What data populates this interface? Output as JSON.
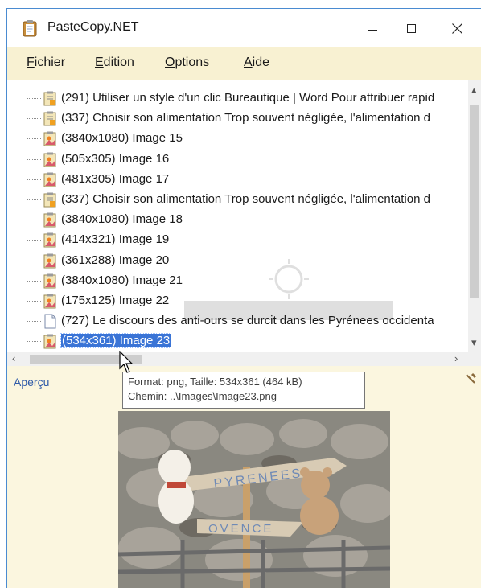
{
  "window": {
    "title": "PasteCopy.NET",
    "controls": [
      "minimize-icon",
      "maximize-icon",
      "close-icon"
    ]
  },
  "menu": {
    "items": [
      {
        "mnemonic": "F",
        "rest": "ichier"
      },
      {
        "mnemonic": "E",
        "rest": "dition"
      },
      {
        "mnemonic": "O",
        "rest": "ptions"
      },
      {
        "mnemonic": "A",
        "rest": "ide"
      }
    ]
  },
  "tree": {
    "items": [
      {
        "icon": "text-clip-icon",
        "label": "(291) Utiliser un style d'un clic Bureautique | Word Pour attribuer rapid",
        "selected": false
      },
      {
        "icon": "text-clip-icon",
        "label": "(337)  Choisir son alimentation Trop souvent négligée, l'alimentation d",
        "selected": false
      },
      {
        "icon": "image-clip-icon",
        "label": "(3840x1080) Image 15",
        "selected": false
      },
      {
        "icon": "image-clip-icon",
        "label": "(505x305) Image 16",
        "selected": false
      },
      {
        "icon": "image-clip-icon",
        "label": "(481x305) Image 17",
        "selected": false
      },
      {
        "icon": "text-clip-icon",
        "label": "(337)  Choisir son alimentation Trop souvent négligée, l'alimentation d",
        "selected": false
      },
      {
        "icon": "image-clip-icon",
        "label": "(3840x1080) Image 18",
        "selected": false
      },
      {
        "icon": "image-clip-icon",
        "label": "(414x321) Image 19",
        "selected": false
      },
      {
        "icon": "image-clip-icon",
        "label": "(361x288) Image 20",
        "selected": false
      },
      {
        "icon": "image-clip-icon",
        "label": "(3840x1080) Image 21",
        "selected": false
      },
      {
        "icon": "image-clip-icon",
        "label": "(175x125) Image 22",
        "selected": false
      },
      {
        "icon": "document-icon",
        "label": "(727) Le discours des anti-ours se durcit dans les Pyrénees occidenta",
        "selected": false
      },
      {
        "icon": "image-clip-icon",
        "label": "(534x361) Image 23",
        "selected": true
      }
    ]
  },
  "tooltip": {
    "line1": "Format: png, Taille: 534x361 (464 kB)",
    "line2": "Chemin: ..\\Images\\Image23.png"
  },
  "preview": {
    "label": "Aperçu",
    "sign_top": "PYRENEES",
    "sign_bottom": "OVENCE"
  },
  "colors": {
    "menubar": "#f8f1d2",
    "selection": "#3a74d6",
    "preview_bg": "#fbf6df",
    "link_blue": "#2e5aa8"
  }
}
